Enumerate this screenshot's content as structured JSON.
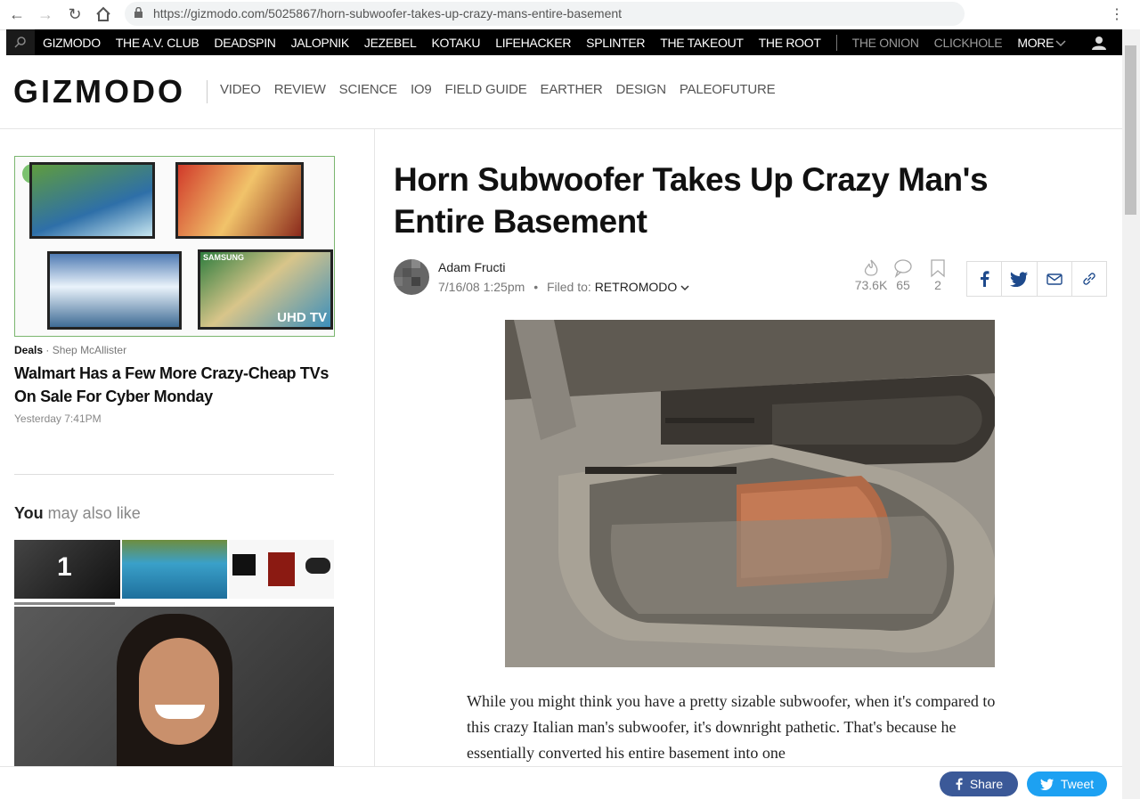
{
  "browser": {
    "url": "https://gizmodo.com/5025867/horn-subwoofer-takes-up-crazy-mans-entire-basement"
  },
  "network_bar": {
    "primary": [
      "GIZMODO",
      "THE A.V. CLUB",
      "DEADSPIN",
      "JALOPNIK",
      "JEZEBEL",
      "KOTAKU",
      "LIFEHACKER",
      "SPLINTER",
      "THE TAKEOUT",
      "THE ROOT"
    ],
    "secondary": [
      "THE ONION",
      "CLICKHOLE",
      "MORE"
    ]
  },
  "header": {
    "logo": "GIZMODO",
    "sections": [
      "VIDEO",
      "REVIEW",
      "SCIENCE",
      "IO9",
      "FIELD GUIDE",
      "EARTHER",
      "DESIGN",
      "PALEOFUTURE"
    ]
  },
  "sidebar": {
    "ad": {
      "brand_label": "SAMSUNG",
      "badge": "UHD TV"
    },
    "promo": {
      "category": "Deals",
      "author": "Shep McAllister",
      "title": "Walmart Has a Few More Crazy-Cheap TVs On Sale For Cyber Monday",
      "time": "Yesterday 7:41PM"
    },
    "ymal_strong": "You",
    "ymal_rest": " may also like",
    "thumb_number": "1"
  },
  "article": {
    "title": "Horn Subwoofer Takes Up Crazy Man's Entire Basement",
    "author": "Adam Fructi",
    "date": "7/16/08 1:25pm",
    "filed_label": "Filed to:",
    "filed_value": "RETROMODO",
    "views": "73.6K",
    "comments": "65",
    "saves": "2",
    "body": "While you might think you have a pretty sizable subwoofer, when it's compared to this crazy Italian man's subwoofer, it's downright pathetic. That's because he essentially converted his entire basement into one"
  },
  "bottom_bar": {
    "share": "Share",
    "tweet": "Tweet"
  },
  "colors": {
    "facebook": "#3b5998",
    "twitter": "#1da1f2",
    "network_bar": "#000000"
  }
}
